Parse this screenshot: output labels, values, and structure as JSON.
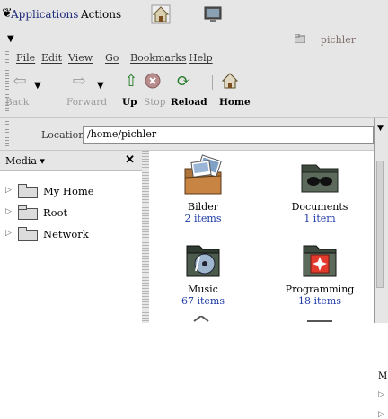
{
  "panel": {
    "applications": "Applications",
    "actions": "Actions",
    "icons": [
      "home-icon",
      "monitor-icon"
    ]
  },
  "window": {
    "title": "pichler"
  },
  "menubar": {
    "items": [
      "File",
      "Edit",
      "View",
      "Go",
      "Bookmarks",
      "Help"
    ]
  },
  "toolbar": {
    "back": "Back",
    "forward": "Forward",
    "up": "Up",
    "stop": "Stop",
    "reload": "Reload",
    "home": "Home"
  },
  "location": {
    "label": "Location:",
    "value": "/home/pichler"
  },
  "sidebar": {
    "title": "Media",
    "items": [
      {
        "label": "My Home"
      },
      {
        "label": "Root"
      },
      {
        "label": "Network"
      }
    ]
  },
  "files": [
    {
      "name": "Bilder",
      "sub": "2 items"
    },
    {
      "name": "Documents",
      "sub": "1 item"
    },
    {
      "name": "Music",
      "sub": "67 items"
    },
    {
      "name": "Programming",
      "sub": "18 items"
    }
  ],
  "right_edge": {
    "m_label": "M"
  },
  "colors": {
    "chrome": "#e6e6e6",
    "link_blue": "#1d3aa6",
    "disabled": "#9a9a9a"
  }
}
